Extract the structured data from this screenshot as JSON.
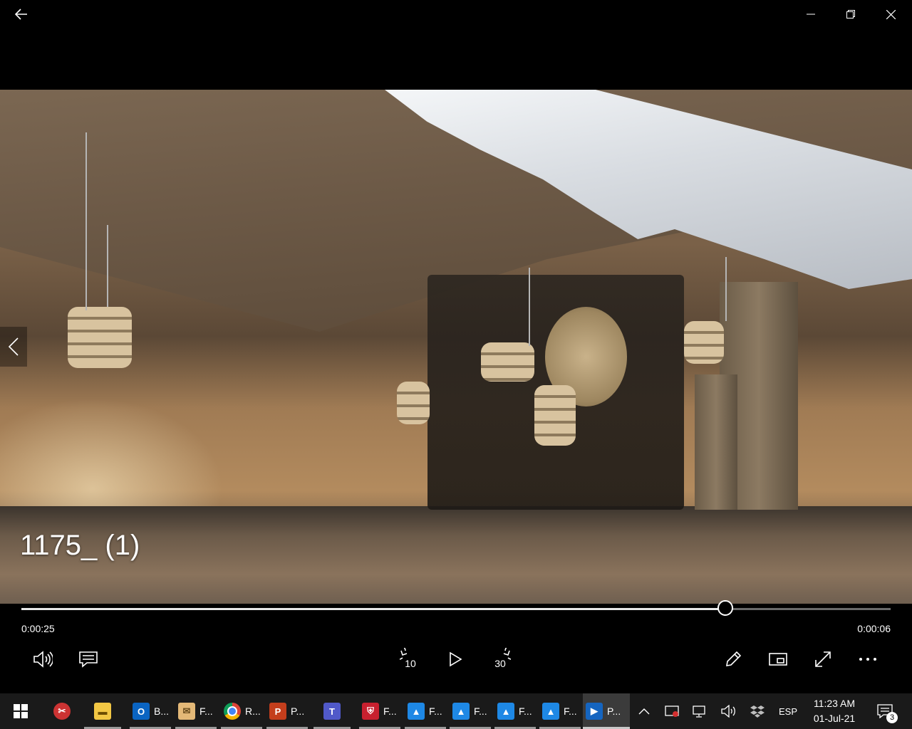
{
  "window": {
    "back_icon": "arrow-left-icon",
    "minimize_icon": "minimize-icon",
    "maximize_icon": "maximize-icon",
    "close_icon": "close-icon"
  },
  "video": {
    "title": "1175_ (1)",
    "elapsed": "0:00:25",
    "remaining": "0:00:06",
    "progress_fraction": 0.81
  },
  "controls": {
    "volume_icon": "volume-icon",
    "captions_icon": "captions-icon",
    "skip_back_label": "10",
    "play_icon": "play-icon",
    "skip_forward_label": "30",
    "edit_icon": "pencil-icon",
    "mini_view_icon": "mini-view-icon",
    "fullscreen_icon": "fullscreen-icon",
    "more_icon": "more-icon"
  },
  "taskbar": {
    "apps": [
      {
        "name": "start",
        "label": ""
      },
      {
        "name": "snipping-tool",
        "label": ""
      },
      {
        "name": "file-explorer",
        "label": ""
      },
      {
        "name": "outlook",
        "label": "B..."
      },
      {
        "name": "mail",
        "label": "F..."
      },
      {
        "name": "chrome",
        "label": "R..."
      },
      {
        "name": "powerpoint",
        "label": "P..."
      },
      {
        "name": "teams",
        "label": ""
      },
      {
        "name": "security",
        "label": "F..."
      },
      {
        "name": "photos-1",
        "label": "F..."
      },
      {
        "name": "photos-2",
        "label": "F..."
      },
      {
        "name": "photos-3",
        "label": "F..."
      },
      {
        "name": "photos-4",
        "label": "F..."
      },
      {
        "name": "movies-tv",
        "label": "P..."
      }
    ],
    "language": "ESP",
    "time": "11:23 AM",
    "date": "01-Jul-21",
    "notification_count": "3"
  }
}
